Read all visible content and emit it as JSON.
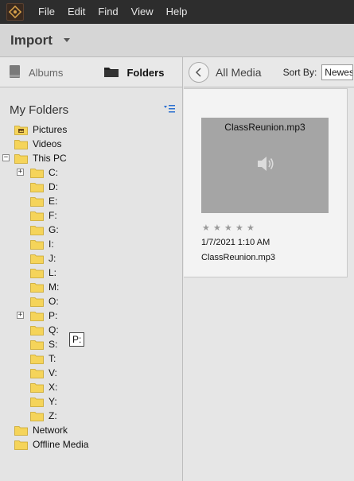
{
  "menubar": {
    "items": [
      "File",
      "Edit",
      "Find",
      "View",
      "Help"
    ]
  },
  "toolbar": {
    "import_label": "Import"
  },
  "left_tabs": {
    "albums": "Albums",
    "folders": "Folders"
  },
  "my_folders": {
    "title": "My Folders"
  },
  "tree": [
    {
      "label": "Pictures",
      "icon": "pictures-folder-icon"
    },
    {
      "label": "Videos",
      "icon": "folder-icon"
    },
    {
      "label": "This PC",
      "icon": "folder-icon",
      "expanded": true
    },
    {
      "label": "C:",
      "icon": "folder-icon",
      "collapsed": true
    },
    {
      "label": "D:",
      "icon": "folder-icon"
    },
    {
      "label": "E:",
      "icon": "folder-icon"
    },
    {
      "label": "F:",
      "icon": "folder-icon"
    },
    {
      "label": "G:",
      "icon": "folder-icon"
    },
    {
      "label": "I:",
      "icon": "folder-icon"
    },
    {
      "label": "J:",
      "icon": "folder-icon"
    },
    {
      "label": "L:",
      "icon": "folder-icon"
    },
    {
      "label": "M:",
      "icon": "folder-icon"
    },
    {
      "label": "O:",
      "icon": "folder-icon"
    },
    {
      "label": "P:",
      "icon": "folder-icon",
      "collapsed": true
    },
    {
      "label": "Q:",
      "icon": "folder-icon"
    },
    {
      "label": "S:",
      "icon": "folder-icon"
    },
    {
      "label": "T:",
      "icon": "folder-icon"
    },
    {
      "label": "V:",
      "icon": "folder-icon"
    },
    {
      "label": "X:",
      "icon": "folder-icon"
    },
    {
      "label": "Y:",
      "icon": "folder-icon"
    },
    {
      "label": "Z:",
      "icon": "folder-icon"
    },
    {
      "label": "Network",
      "icon": "folder-icon"
    },
    {
      "label": "Offline Media",
      "icon": "folder-icon"
    }
  ],
  "tooltip": {
    "text": "P:"
  },
  "media_header": {
    "title": "All Media",
    "sort_label": "Sort By:",
    "sort_value": "Newest"
  },
  "media_items": [
    {
      "thumb_title": "ClassReunion.mp3",
      "rating": 0,
      "rating_max": 5,
      "date": "1/7/2021 1:10 AM",
      "filename": "ClassReunion.mp3"
    }
  ],
  "colors": {
    "menubar_bg": "#2d2d2d",
    "folder_yellow": "#f5d45a",
    "thumb_bg": "#a5a5a5"
  }
}
